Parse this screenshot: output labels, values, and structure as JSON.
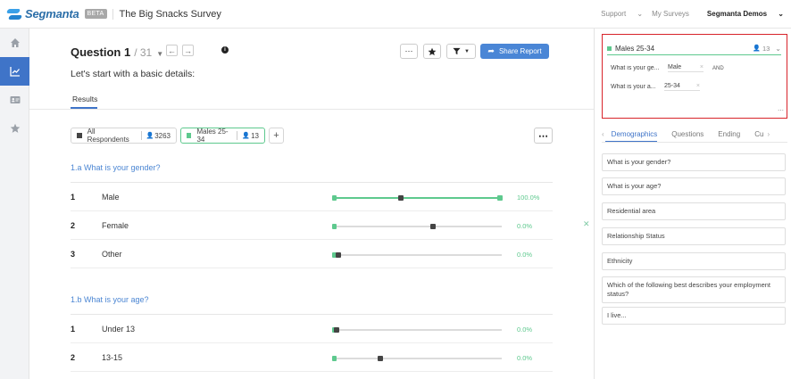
{
  "app": {
    "brand": "Segmanta",
    "beta": "BETA",
    "survey_title": "The Big Snacks Survey",
    "nav": {
      "support": "Support",
      "my_surveys": "My Surveys",
      "account": "Segmanta Demos"
    }
  },
  "question": {
    "title": "Question 1",
    "of": "/ 31",
    "subtitle": "Let's start with a basic details:",
    "tab": "Results"
  },
  "toolbar": {
    "share": "Share Report",
    "more": "⋯"
  },
  "segments": [
    {
      "label": "All Respondents",
      "count": "3263",
      "color": "#444444"
    },
    {
      "label": "Males 25-34",
      "count": "13",
      "color": "#5ec98e"
    }
  ],
  "sections": [
    {
      "title": "1.a What is your gender?",
      "answers": [
        {
          "num": "1",
          "label": "Male",
          "pct": "100.0%",
          "value": 1.0
        },
        {
          "num": "2",
          "label": "Female",
          "pct": "0.0%",
          "value": 0.0
        },
        {
          "num": "3",
          "label": "Other",
          "pct": "0.0%",
          "value": 0.0
        }
      ]
    },
    {
      "title": "1.b What is your age?",
      "answers": [
        {
          "num": "1",
          "label": "Under 13",
          "pct": "0.0%",
          "value": 0.0
        },
        {
          "num": "2",
          "label": "13-15",
          "pct": "0.0%",
          "value": 0.0
        }
      ]
    }
  ],
  "filter": {
    "name": "Males 25-34",
    "count": "13",
    "conditions": [
      {
        "question": "What is your ge...",
        "value": "Male",
        "joiner": "AND"
      },
      {
        "question": "What is your a...",
        "value": "25-34",
        "joiner": ""
      }
    ]
  },
  "panel_tabs": [
    "Demographics",
    "Questions",
    "Ending",
    "Cu"
  ],
  "panel_questions": [
    "What is your gender?",
    "What is your age?",
    "Residential area",
    "Relationship Status",
    "Ethnicity",
    "Which of the following best describes your employment status?",
    "I live..."
  ],
  "colors": {
    "accent": "#3f74c8",
    "green": "#5ec98e",
    "highlight": "#d8232a"
  }
}
